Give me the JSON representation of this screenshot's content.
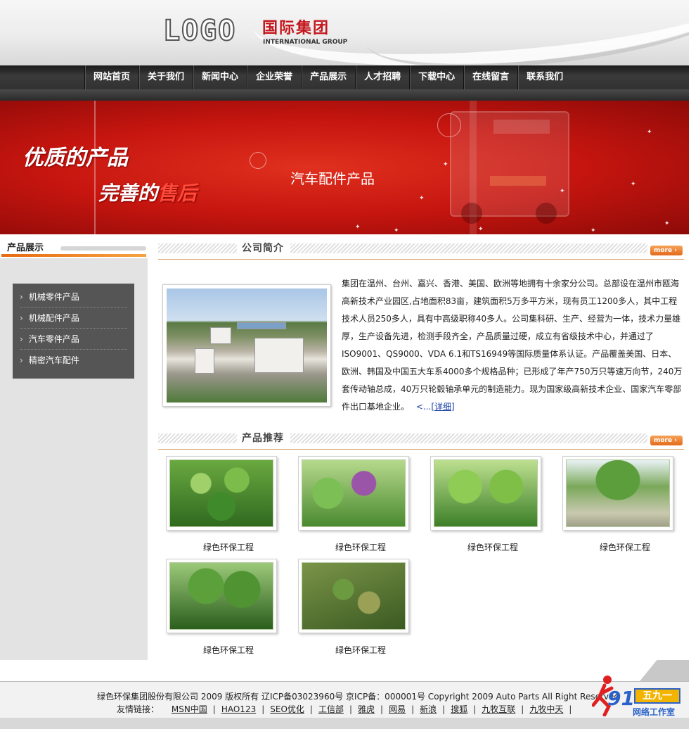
{
  "header": {
    "logo_text": "LOGO",
    "company_cn": "国际集团",
    "company_en": "INTERNATIONAL GROUP"
  },
  "nav": {
    "items": [
      "网站首页",
      "关于我们",
      "新闻中心",
      "企业荣誉",
      "产品展示",
      "人才招聘",
      "下载中心",
      "在线留言",
      "联系我们"
    ]
  },
  "banner": {
    "slogan_line1": "优质的产品",
    "slogan_line2_a": "完善的",
    "slogan_line2_b": "售后",
    "subtitle": "汽车配件产品"
  },
  "sidebar": {
    "title": "产品展示",
    "items": [
      "机械零件产品",
      "机械配件产品",
      "汽车零件产品",
      "精密汽车配件"
    ]
  },
  "about": {
    "title": "公司简介",
    "more_label": "more",
    "text": "集团在温州、台州、嘉兴、香港、美国、欧洲等地拥有十余家分公司。总部设在温州市瓯海高新技术产业园区,占地面积83亩，建筑面积5万多平方米，现有员工1200多人，其中工程技术人员250多人，具有中高级职称40多人。公司集科研、生产、经营为一体，技术力量雄厚，生产设备先进，检测手段齐全，产品质量过硬，成立有省级技术中心，并通过了ISO9001、QS9000、VDA 6.1和TS16949等国际质量体系认证。产品覆盖美国、日本、欧洲、韩国及中国五大车系4000多个规格品种；已形成了年产750万只等速万向节，240万套传动轴总成，40万只轮毂轴承单元的制造能力。现为国家级高新技术企业、国家汽车零部件出口基地企业。",
    "read_more_prefix": "<...",
    "read_more": "[详细]"
  },
  "products": {
    "title": "产品推荐",
    "more_label": "more",
    "items": [
      {
        "caption": "绿色环保工程"
      },
      {
        "caption": "绿色环保工程"
      },
      {
        "caption": "绿色环保工程"
      },
      {
        "caption": "绿色环保工程"
      },
      {
        "caption": "绿色环保工程"
      },
      {
        "caption": "绿色环保工程"
      }
    ]
  },
  "footer": {
    "copyright": "绿色环保集团股份有限公司 2009 版权所有 辽ICP备03023960号 京ICP备：000001号 Copyright 2009 Auto Parts All Right Reserved",
    "links_label": "友情链接：",
    "links": [
      "MSN中国",
      "HAO123",
      "SEO优化",
      "工信部",
      "雅虎",
      "网易",
      "新浪",
      "搜狐",
      "九牧互联",
      "九牧中天"
    ]
  },
  "badge": {
    "number": "91",
    "cn": "五九一",
    "studio": "网络工作室"
  },
  "colors": {
    "brand_red": "#c4161c",
    "accent_orange": "#e46a1a",
    "nav_dark": "#2a2a2a",
    "sidebar_gray": "#e3e3e3",
    "link_blue": "#1a3fa8"
  }
}
